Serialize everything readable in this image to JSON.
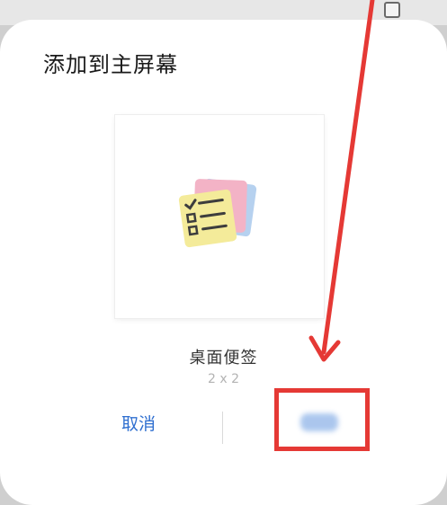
{
  "dialog": {
    "title": "添加到主屏幕",
    "widget_name": "桌面便签",
    "widget_size": "2 x 2",
    "cancel_label": "取消",
    "add_label": ""
  },
  "icons": {
    "preview": "sticky-notes-icon",
    "background_checkbox": "checkbox-icon"
  },
  "colors": {
    "accent": "#2f6fd0",
    "annotation": "#e53935",
    "note_yellow": "#f4eb9a",
    "note_pink": "#f3b3c6",
    "note_blue": "#b6d1ef"
  }
}
